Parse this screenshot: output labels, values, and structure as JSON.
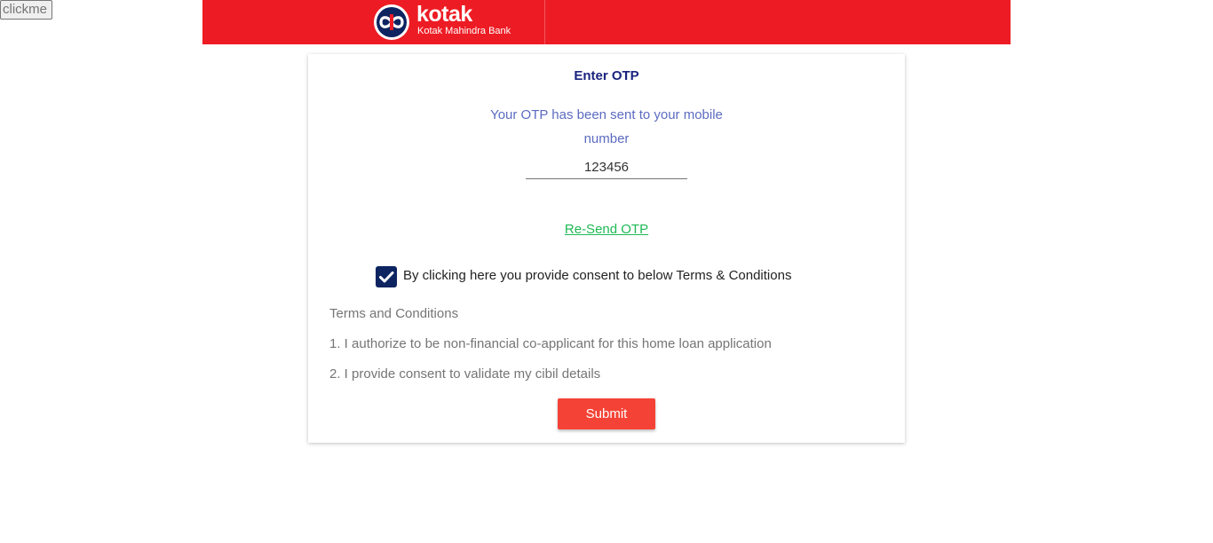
{
  "debug_button": {
    "label": "clickme"
  },
  "header": {
    "brand_name": "kotak",
    "brand_subtitle": "Kotak Mahindra Bank",
    "brand_color": "#ed1c24",
    "logo_icon": "kotak-infinity-logo"
  },
  "otp_form": {
    "title": "Enter OTP",
    "message": "Your OTP has been sent to your mobile number",
    "otp_value": "123456",
    "resend_label": "Re-Send OTP",
    "consent_checked": true,
    "consent_label": "By clicking here you provide consent to below Terms & Conditions",
    "terms_heading": "Terms and Conditions",
    "terms": [
      "1. I authorize to be non-financial co-applicant for this home loan application",
      "2. I provide consent to validate my cibil details"
    ],
    "submit_label": "Submit"
  },
  "colors": {
    "title": "#1a237e",
    "message": "#5c6bc0",
    "link": "#1db954",
    "checkbox": "#0d2461",
    "submit": "#f44336"
  }
}
